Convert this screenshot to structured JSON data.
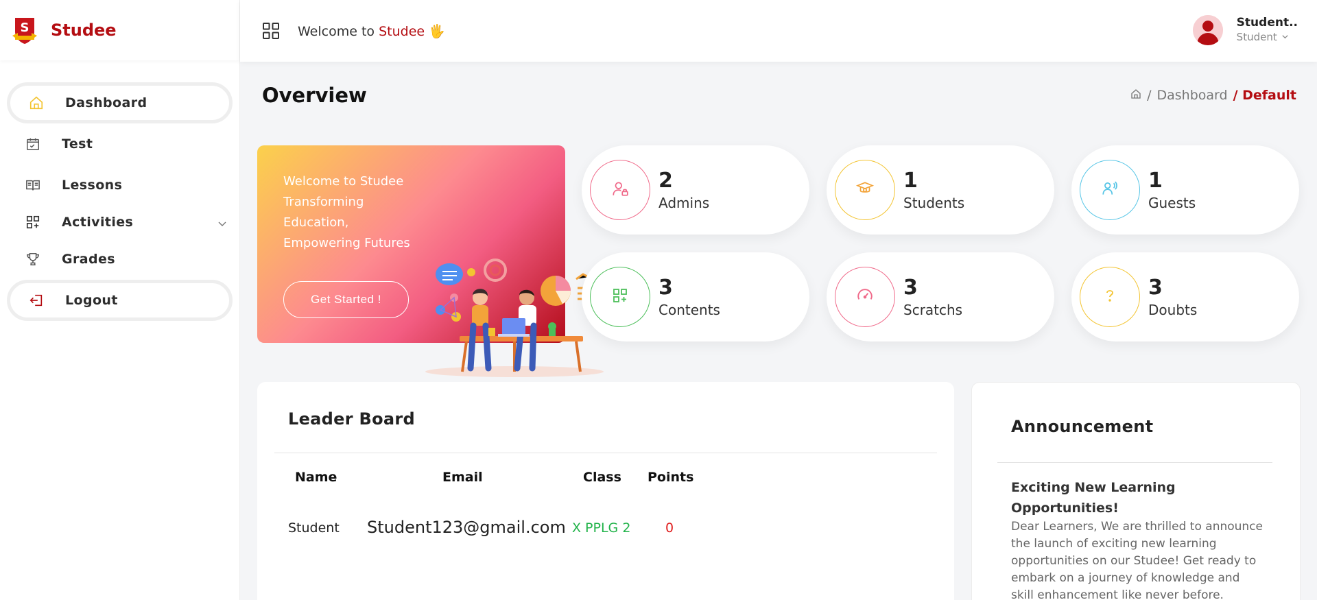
{
  "brand": {
    "name": "Studee",
    "logo_letter": "S"
  },
  "sidebar": {
    "items": [
      {
        "label": "Dashboard",
        "icon": "home-icon"
      },
      {
        "label": "Test",
        "icon": "calendar-check-icon"
      },
      {
        "label": "Lessons",
        "icon": "book-open-icon"
      },
      {
        "label": "Activities",
        "icon": "apps-add-icon"
      },
      {
        "label": "Grades",
        "icon": "trophy-icon"
      },
      {
        "label": "Logout",
        "icon": "logout-icon"
      }
    ]
  },
  "header": {
    "welcome_prefix": "Welcome to",
    "welcome_brand": "Studee",
    "wave": "🖐",
    "user_name": "Student..",
    "user_role": "Student"
  },
  "overview": {
    "title": "Overview",
    "breadcrumb": {
      "sep1": "/",
      "dashboard": "Dashboard",
      "current": "/ Default"
    }
  },
  "hero": {
    "title": "Welcome to Studee",
    "line1": "Transforming",
    "line2": "Education,",
    "line3": "Empowering Futures",
    "button": "Get Started !"
  },
  "stats": [
    {
      "value": "2",
      "label": "Admins",
      "color": "#f06a8a",
      "icon": "user-lock-icon"
    },
    {
      "value": "1",
      "label": "Students",
      "color": "#f3c431",
      "icon": "graduation-cap-icon"
    },
    {
      "value": "1",
      "label": "Guests",
      "color": "#56c5e6",
      "icon": "users-icon"
    },
    {
      "value": "3",
      "label": "Contents",
      "color": "#4cbf5a",
      "icon": "apps-add-icon"
    },
    {
      "value": "3",
      "label": "Scratchs",
      "color": "#f06a8a",
      "icon": "speedometer-icon"
    },
    {
      "value": "3",
      "label": "Doubts",
      "color": "#f3c431",
      "icon": "question-icon"
    }
  ],
  "leaderboard": {
    "title": "Leader Board",
    "headers": {
      "name": "Name",
      "email": "Email",
      "class": "Class",
      "points": "Points"
    },
    "rows": [
      {
        "name": "Student",
        "email": "Student123@gmail.com",
        "class": "X PPLG 2",
        "points": "0"
      }
    ]
  },
  "announcement": {
    "title": "Announcement",
    "headline": "Exciting New Learning Opportunities!",
    "body": "Dear Learners, We are thrilled to announce the launch of exciting new learning opportunities on our Studee! Get ready to embark on a journey of knowledge and skill enhancement like never before."
  },
  "colors": {
    "accent": "#b40d12"
  }
}
